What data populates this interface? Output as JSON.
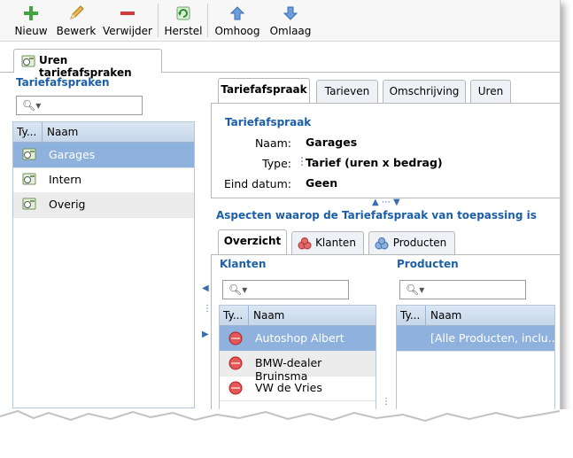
{
  "toolbar": {
    "buttons": [
      {
        "label": "Nieuw",
        "icon": "plus-icon"
      },
      {
        "label": "Bewerk",
        "icon": "pencil-icon"
      },
      {
        "label": "Verwijder",
        "icon": "minus-icon"
      },
      {
        "label": "Herstel",
        "icon": "refresh-icon"
      },
      {
        "label": "Omhoog",
        "icon": "arrow-up-icon"
      },
      {
        "label": "Omlaag",
        "icon": "arrow-down-icon"
      }
    ]
  },
  "main_tab": {
    "label": "Uren tariefafspraken"
  },
  "left": {
    "title": "Tariefafspraken",
    "search_placeholder": "",
    "columns": [
      "Ty...",
      "Naam"
    ],
    "rows": [
      {
        "name": "Garages",
        "selected": true
      },
      {
        "name": "Intern",
        "selected": false
      },
      {
        "name": "Overig",
        "selected": false
      }
    ]
  },
  "detail_tabs": [
    "Tariefafspraak",
    "Tarieven",
    "Omschrijving",
    "Uren"
  ],
  "detail": {
    "title": "Tariefafspraak",
    "fields": [
      {
        "label": "Naam:",
        "value": "Garages"
      },
      {
        "label": "Type:",
        "value": "Tarief (uren x bedrag)"
      },
      {
        "label": "Eind datum:",
        "value": "Geen"
      }
    ]
  },
  "aspects": {
    "title": "Aspecten waarop de Tariefafspraak van toepassing is",
    "tabs": [
      "Overzicht",
      "Klanten",
      "Producten"
    ],
    "klanten": {
      "title": "Klanten",
      "columns": [
        "Ty...",
        "Naam"
      ],
      "rows": [
        {
          "name": "Autoshop Albert",
          "selected": true
        },
        {
          "name": "BMW-dealer Bruinsma",
          "selected": false
        },
        {
          "name": "VW de Vries",
          "selected": false
        }
      ]
    },
    "producten": {
      "title": "Producten",
      "columns": [
        "Ty...",
        "Naam"
      ],
      "rows": [
        {
          "name": "[Alle Producten, inclu...",
          "selected": true
        }
      ]
    }
  },
  "colors": {
    "accent": "#1c5fa8",
    "selected_row": "#8eb2dd",
    "header": "#c6d7ea"
  }
}
